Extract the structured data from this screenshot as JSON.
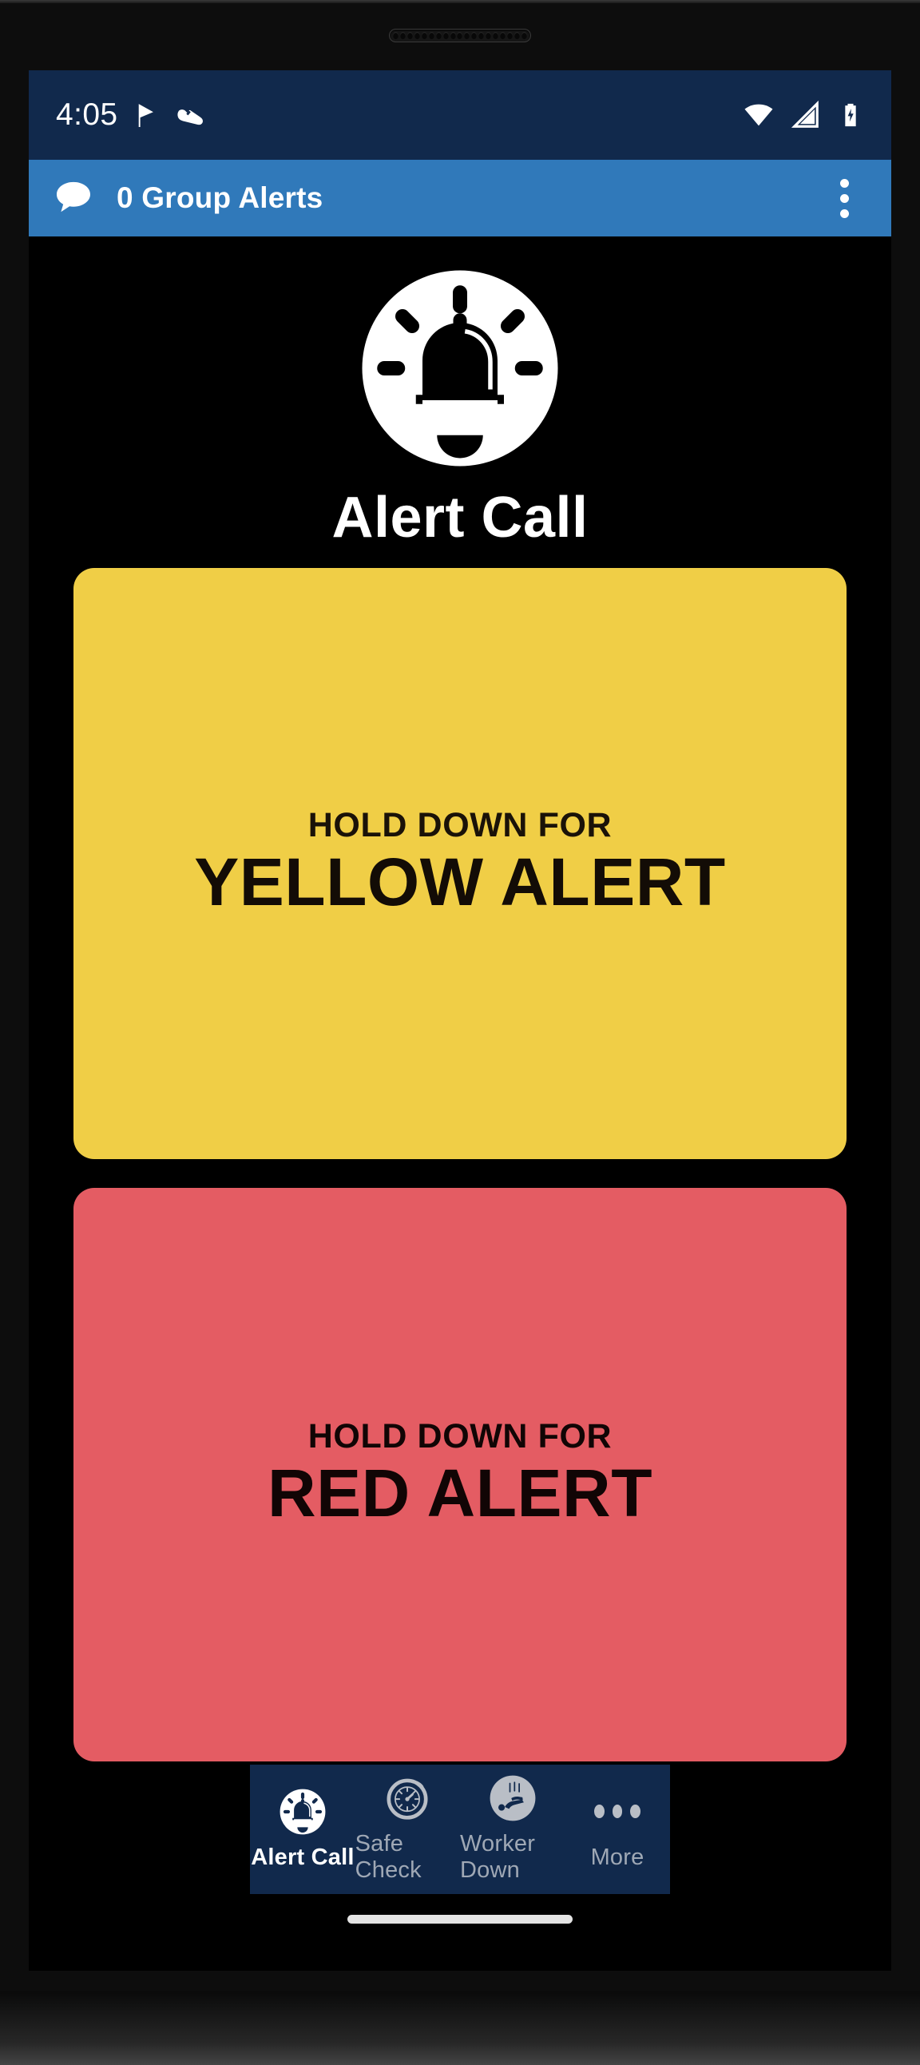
{
  "device": {
    "speaker_grille_holes": 19
  },
  "status_bar": {
    "time": "4:05",
    "left_icons": [
      "flag-icon",
      "shoe-icon"
    ],
    "right_icons": [
      "wifi-icon",
      "cellular-signal-icon",
      "battery-charging-icon"
    ],
    "background": "#11294c"
  },
  "app_bar": {
    "chat_icon": "chat-bubble-icon",
    "title": "0 Group Alerts",
    "overflow_icon": "more-vertical-icon",
    "background": "#3079ba"
  },
  "brand": {
    "logo_icon": "alarm-bell-icon",
    "title": "Alert Call"
  },
  "alerts": [
    {
      "id": "yellow",
      "hold_label": "HOLD DOWN FOR",
      "name": "YELLOW ALERT",
      "color": "#f0ce46",
      "text_color": "#1a1208"
    },
    {
      "id": "red",
      "hold_label": "HOLD DOWN FOR",
      "name": "RED ALERT",
      "color": "#e45c63",
      "text_color": "#110505"
    }
  ],
  "bottom_nav": {
    "background": "#11294c",
    "active_color": "#ffffff",
    "inactive_color": "#9fa8b5",
    "items": [
      {
        "label": "Alert Call",
        "icon": "alarm-bell-icon",
        "active": true
      },
      {
        "label": "Safe Check",
        "icon": "stopwatch-icon",
        "active": false
      },
      {
        "label": "Worker Down",
        "icon": "worker-down-icon",
        "active": false
      },
      {
        "label": "More",
        "icon": "more-dots-icon",
        "active": false
      }
    ]
  }
}
